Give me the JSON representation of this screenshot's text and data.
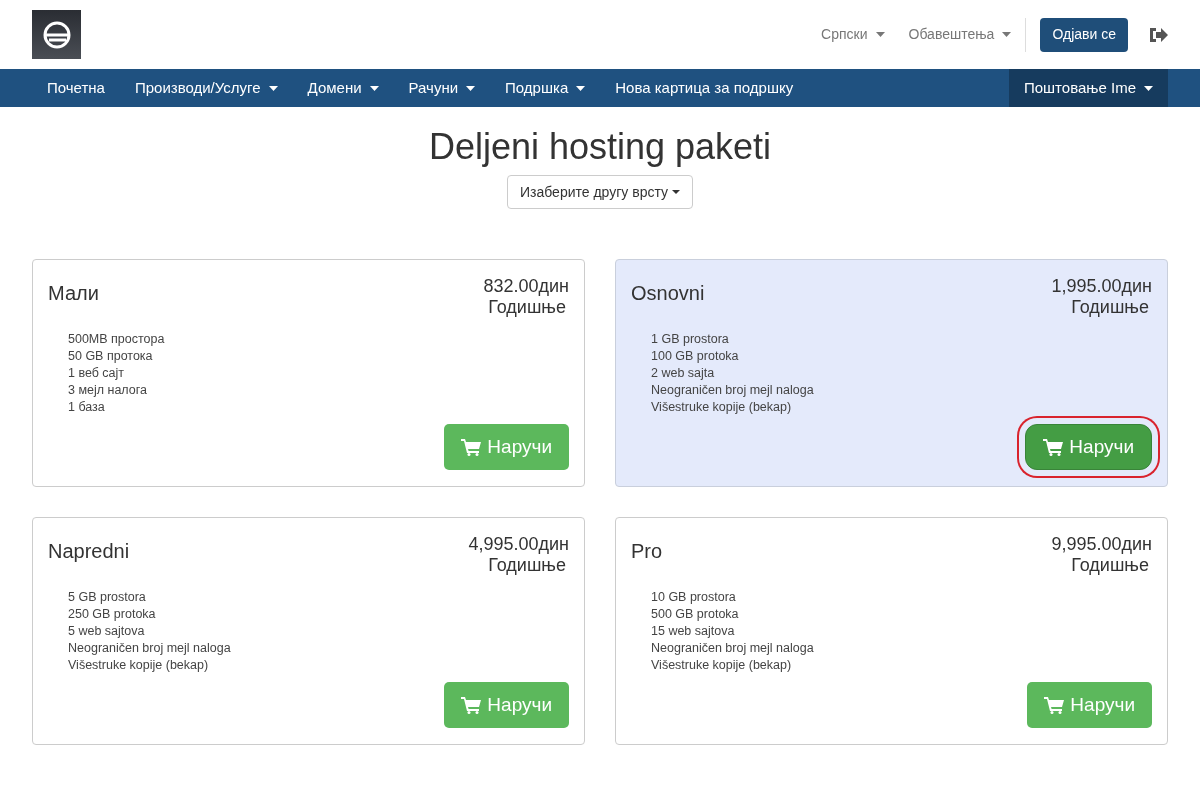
{
  "header": {
    "links": [
      {
        "label": "Српски",
        "has_menu": true
      },
      {
        "label": "Обавештења",
        "has_menu": true
      }
    ],
    "logout_button": "Одјави се"
  },
  "nav": {
    "items": [
      {
        "label": "Почетна",
        "has_menu": false
      },
      {
        "label": "Производи/Услуге",
        "has_menu": true
      },
      {
        "label": "Домени",
        "has_menu": true
      },
      {
        "label": "Рачуни",
        "has_menu": true
      },
      {
        "label": "Подршка",
        "has_menu": true
      },
      {
        "label": "Нова картица за подршку",
        "has_menu": false
      }
    ],
    "account": {
      "label": "Поштовање Ime",
      "has_menu": true
    }
  },
  "page": {
    "title": "Deljeni hosting paketi",
    "category_button": "Изаберите другу врсту"
  },
  "packages": [
    {
      "name": "Мали",
      "price": "832.00дин",
      "cycle": "Годишње",
      "features": [
        "500MB простора",
        "50 GB протока",
        "1 веб сајт",
        "3 мејл налога",
        "1 база"
      ],
      "order_button": "Наручи",
      "selected": false
    },
    {
      "name": "Osnovni",
      "price": "1,995.00дин",
      "cycle": "Годишње",
      "features": [
        "1 GB prostora",
        "100 GB protoka",
        "2 web sajta",
        "Neograničen broj mejl naloga",
        "Višestruke kopije (bekap)"
      ],
      "order_button": "Наручи",
      "selected": true
    },
    {
      "name": "Napredni",
      "price": "4,995.00дин",
      "cycle": "Годишње",
      "features": [
        "5 GB prostora",
        "250 GB protoka",
        "5 web sajtova",
        "Neograničen broj mejl naloga",
        "Višestruke kopije (bekap)"
      ],
      "order_button": "Наручи",
      "selected": false
    },
    {
      "name": "Pro",
      "price": "9,995.00дин",
      "cycle": "Годишње",
      "features": [
        "10 GB prostora",
        "500 GB protoka",
        "15 web sajtova",
        "Neograničen broj mejl naloga",
        "Višestruke kopije (bekap)"
      ],
      "order_button": "Наручи",
      "selected": false
    }
  ]
}
